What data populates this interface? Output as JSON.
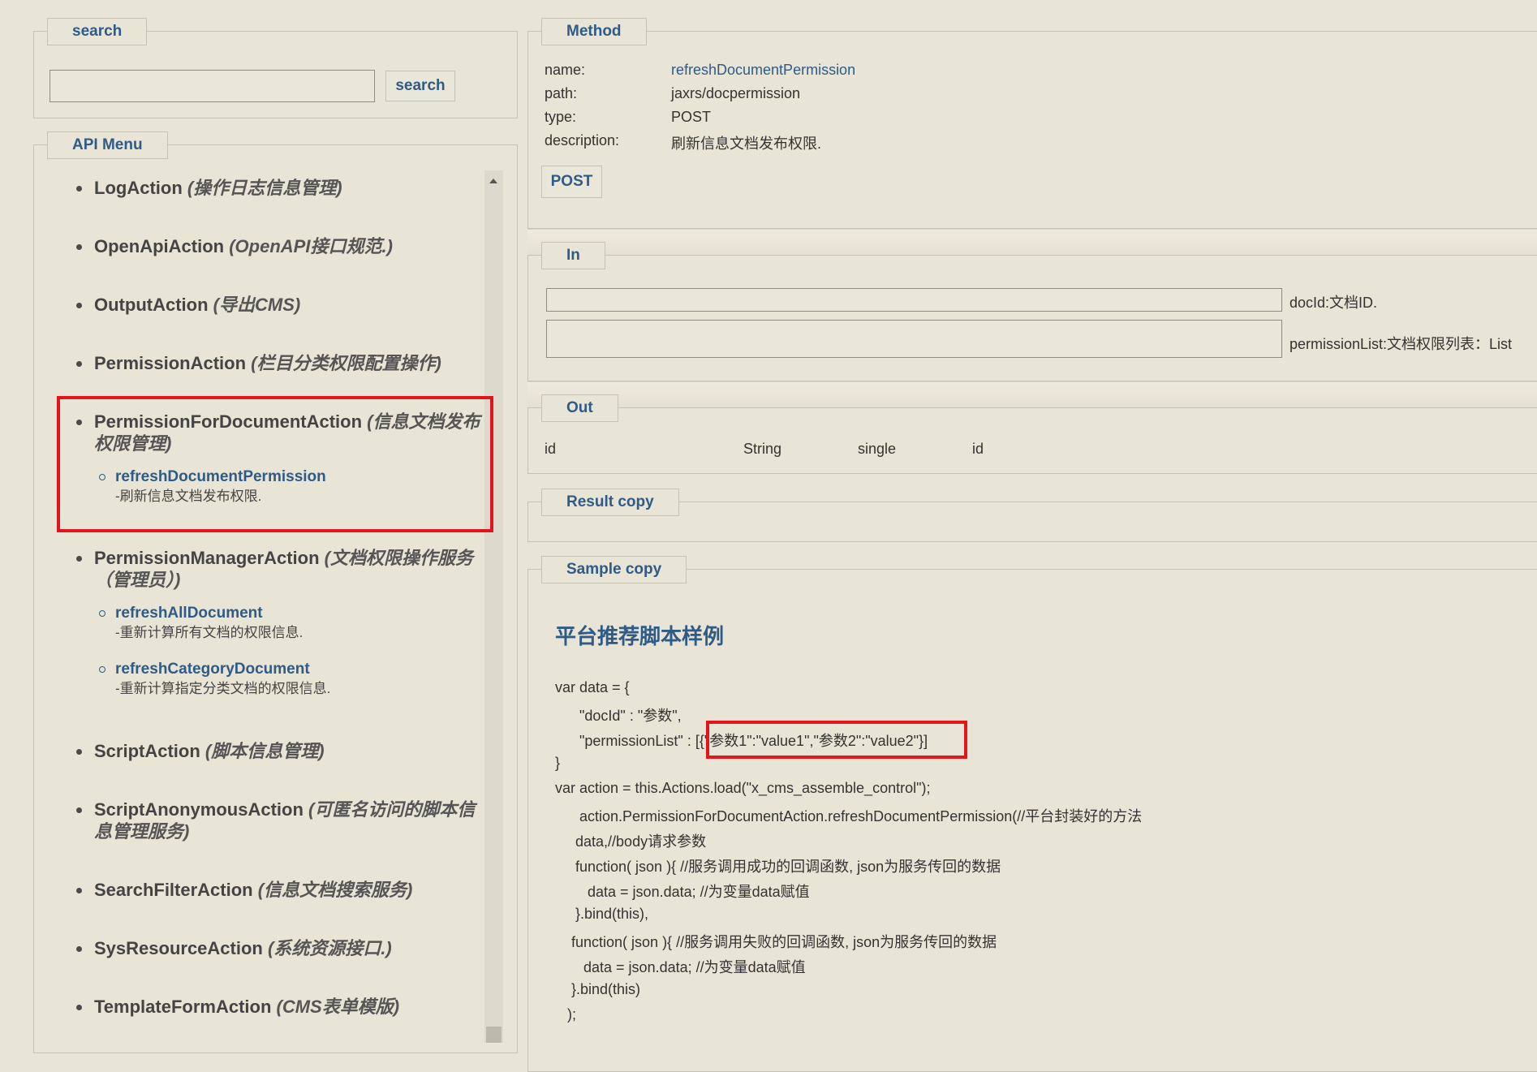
{
  "search": {
    "legend": "search",
    "input_value": "",
    "button_label": "search"
  },
  "api_menu": {
    "legend": "API Menu",
    "items": [
      {
        "name": "LogAction",
        "desc": "(操作日志信息管理)"
      },
      {
        "name": "OpenApiAction",
        "desc": "(OpenAPI接口规范.)"
      },
      {
        "name": "OutputAction",
        "desc": "(导出CMS)"
      },
      {
        "name": "PermissionAction",
        "desc": "(栏目分类权限配置操作)"
      },
      {
        "name": "PermissionForDocumentAction",
        "desc": "(信息文档发布权限管理)",
        "subs": [
          {
            "name": "refreshDocumentPermission",
            "desc": "-刷新信息文档发布权限."
          }
        ]
      },
      {
        "name": "PermissionManagerAction",
        "desc": "(文档权限操作服务（管理员）)",
        "subs": [
          {
            "name": "refreshAllDocument",
            "desc": "-重新计算所有文档的权限信息."
          },
          {
            "name": "refreshCategoryDocument",
            "desc": "-重新计算指定分类文档的权限信息."
          }
        ]
      },
      {
        "name": "ScriptAction",
        "desc": "(脚本信息管理)"
      },
      {
        "name": "ScriptAnonymousAction",
        "desc": "(可匿名访问的脚本信息管理服务)"
      },
      {
        "name": "SearchFilterAction",
        "desc": "(信息文档搜索服务)"
      },
      {
        "name": "SysResourceAction",
        "desc": "(系统资源接口.)"
      },
      {
        "name": "TemplateFormAction",
        "desc": "(CMS表单模版)"
      }
    ]
  },
  "method": {
    "legend": "Method",
    "name_label": "name:",
    "name_value": "refreshDocumentPermission",
    "path_label": "path:",
    "path_value": "jaxrs/docpermission",
    "type_label": "type:",
    "type_value": "POST",
    "description_label": "description:",
    "description_value": "刷新信息文档发布权限.",
    "button_label": "POST"
  },
  "in": {
    "legend": "In",
    "fields": [
      {
        "value": "",
        "label": "docId:文档ID."
      },
      {
        "value": "",
        "label": "permissionList:文档权限列表：List"
      }
    ]
  },
  "out": {
    "legend": "Out",
    "row": {
      "name": "id",
      "type": "String",
      "mode": "single",
      "desc": "id"
    }
  },
  "result": {
    "legend": "Result copy"
  },
  "sample": {
    "legend": "Sample copy",
    "heading": "平台推荐脚本样例",
    "lines": [
      "var data = {",
      "      \"docId\" : \"参数\",",
      "      \"permissionList\" : [{\"参数1\":\"value1\",\"参数2\":\"value2\"}]",
      "}",
      "var action = this.Actions.load(\"x_cms_assemble_control\");",
      "      action.PermissionForDocumentAction.refreshDocumentPermission(//平台封装好的方法",
      "     data,//body请求参数",
      "     function( json ){ //服务调用成功的回调函数, json为服务传回的数据",
      "        data = json.data; //为变量data赋值",
      "     }.bind(this),",
      "    function( json ){ //服务调用失败的回调函数, json为服务传回的数据",
      "       data = json.data; //为变量data赋值",
      "    }.bind(this)",
      "   );"
    ]
  },
  "colors": {
    "background": "#e8e4d6",
    "accent": "#2f5b86",
    "highlight": "#e3141c"
  }
}
